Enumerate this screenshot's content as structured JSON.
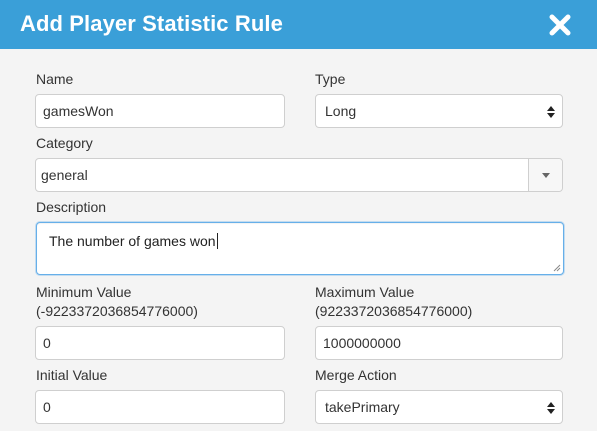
{
  "dialog": {
    "title": "Add Player Statistic Rule",
    "close_icon": "close-x-icon",
    "header_color": "#3a9fd8"
  },
  "form": {
    "name": {
      "label": "Name",
      "value": "gamesWon"
    },
    "type": {
      "label": "Type",
      "value": "Long"
    },
    "category": {
      "label": "Category",
      "value": "general"
    },
    "description": {
      "label": "Description",
      "value": "The number of games won"
    },
    "min": {
      "label": "Minimum Value",
      "hint": "(-9223372036854776000)",
      "value": "0"
    },
    "max": {
      "label": "Maximum Value",
      "hint": "(9223372036854776000)",
      "value": "1000000000"
    },
    "initial": {
      "label": "Initial Value",
      "value": "0"
    },
    "merge": {
      "label": "Merge Action",
      "value": "takePrimary"
    }
  }
}
